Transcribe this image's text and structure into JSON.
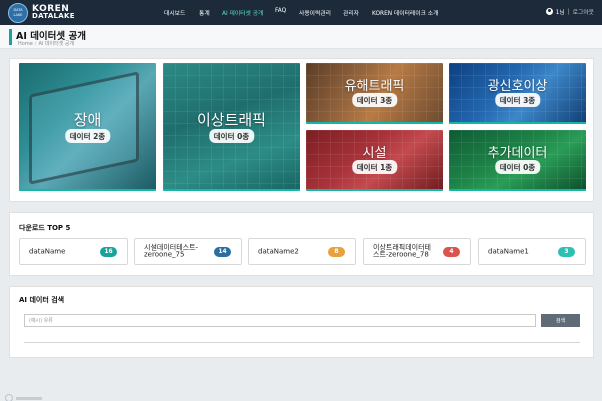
{
  "logo": {
    "circle_top": "DATA",
    "circle_bottom": "LAKE",
    "name_line1": "KOREN",
    "name_line2": "DATALAKE"
  },
  "nav": {
    "items": [
      {
        "label": "대시보드",
        "active": false
      },
      {
        "label": "통계",
        "active": false
      },
      {
        "label": "AI 데이터셋 공개",
        "active": true
      },
      {
        "label": "FAQ",
        "active": false
      },
      {
        "label": "사용이력관리",
        "active": false
      },
      {
        "label": "관리자",
        "active": false
      },
      {
        "label": "KOREN 데이터레이크 소개",
        "active": false
      }
    ],
    "user_name": "1님",
    "separator": "|",
    "logout": "로그아웃"
  },
  "header": {
    "title": "AI 데이터셋 공개",
    "breadcrumb_home": "Home",
    "breadcrumb_sep": "/",
    "breadcrumb_current": "AI 데이터셋 공개"
  },
  "categories": [
    {
      "name": "장애",
      "count": "데이터 2종"
    },
    {
      "name": "이상트래픽",
      "count": "데이터 0종"
    },
    {
      "name": "유해트래픽",
      "count": "데이터 3종"
    },
    {
      "name": "광신호이상",
      "count": "데이터 3종"
    },
    {
      "name": "시설",
      "count": "데이터 1종"
    },
    {
      "name": "추가데이터",
      "count": "데이터 0종"
    }
  ],
  "top5": {
    "title": "다운로드 TOP 5",
    "items": [
      {
        "name": "dataName",
        "count": "16",
        "color": "#1aa39a"
      },
      {
        "name": "시설데이터테스트-zeroone_75",
        "count": "14",
        "color": "#2b6fa0"
      },
      {
        "name": "dataName2",
        "count": "8",
        "color": "#e8a23d"
      },
      {
        "name": "이상트래픽데이터테스트-zeroone_78",
        "count": "4",
        "color": "#d9534f"
      },
      {
        "name": "dataName1",
        "count": "3",
        "color": "#2bc0b2"
      }
    ]
  },
  "search": {
    "title": "AI 데이터 검색",
    "placeholder": "(예시) 유류",
    "button": "검색"
  }
}
